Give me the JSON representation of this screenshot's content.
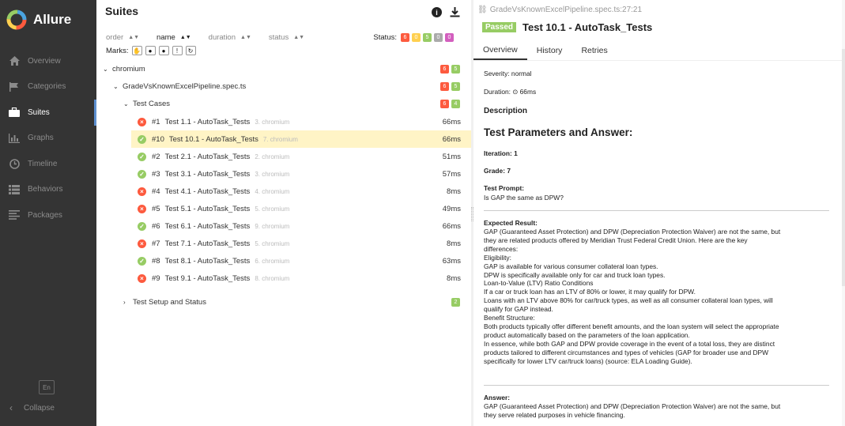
{
  "app": {
    "name": "Allure"
  },
  "sidebar": {
    "items": [
      {
        "label": "Overview",
        "icon": "home-icon"
      },
      {
        "label": "Categories",
        "icon": "flag-icon"
      },
      {
        "label": "Suites",
        "icon": "briefcase-icon",
        "active": true
      },
      {
        "label": "Graphs",
        "icon": "bar-chart-icon"
      },
      {
        "label": "Timeline",
        "icon": "clock-icon"
      },
      {
        "label": "Behaviors",
        "icon": "list-icon"
      },
      {
        "label": "Packages",
        "icon": "align-left-icon"
      }
    ],
    "language": "En",
    "collapse_label": "Collapse"
  },
  "suites": {
    "title": "Suites",
    "sort": {
      "order": "order",
      "name": "name",
      "duration": "duration",
      "status": "status"
    },
    "status_label": "Status:",
    "status_counts": [
      "6",
      "0",
      "5",
      "0",
      "0"
    ],
    "marks_label": "Marks:",
    "tree": {
      "root": {
        "label": "chromium",
        "counts": [
          "6",
          "5"
        ]
      },
      "file": {
        "label": "GradeVsKnownExcelPipeline.spec.ts",
        "counts": [
          "6",
          "5"
        ]
      },
      "group": {
        "label": "Test Cases",
        "counts": [
          "6",
          "4"
        ]
      },
      "tests": [
        {
          "num": "#1",
          "name": "Test 1.1 - AutoTask_Tests",
          "meta": "3. chromium",
          "duration": "66ms",
          "status": "failed"
        },
        {
          "num": "#10",
          "name": "Test 10.1 - AutoTask_Tests",
          "meta": "7. chromium",
          "duration": "66ms",
          "status": "passed",
          "selected": true
        },
        {
          "num": "#2",
          "name": "Test 2.1 - AutoTask_Tests",
          "meta": "2. chromium",
          "duration": "51ms",
          "status": "passed"
        },
        {
          "num": "#3",
          "name": "Test 3.1 - AutoTask_Tests",
          "meta": "3. chromium",
          "duration": "57ms",
          "status": "passed"
        },
        {
          "num": "#4",
          "name": "Test 4.1 - AutoTask_Tests",
          "meta": "4. chromium",
          "duration": "8ms",
          "status": "failed"
        },
        {
          "num": "#5",
          "name": "Test 5.1 - AutoTask_Tests",
          "meta": "5. chromium",
          "duration": "49ms",
          "status": "failed"
        },
        {
          "num": "#6",
          "name": "Test 6.1 - AutoTask_Tests",
          "meta": "9. chromium",
          "duration": "66ms",
          "status": "passed"
        },
        {
          "num": "#7",
          "name": "Test 7.1 - AutoTask_Tests",
          "meta": "5. chromium",
          "duration": "8ms",
          "status": "failed"
        },
        {
          "num": "#8",
          "name": "Test 8.1 - AutoTask_Tests",
          "meta": "6. chromium",
          "duration": "63ms",
          "status": "passed"
        },
        {
          "num": "#9",
          "name": "Test 9.1 - AutoTask_Tests",
          "meta": "8. chromium",
          "duration": "8ms",
          "status": "failed"
        }
      ],
      "setup": {
        "label": "Test Setup and Status",
        "counts": [
          "2"
        ]
      }
    }
  },
  "detail": {
    "path": "GradeVsKnownExcelPipeline.spec.ts:27:21",
    "status_badge": "Passed",
    "title": "Test 10.1 - AutoTask_Tests",
    "tabs": [
      "Overview",
      "History",
      "Retries"
    ],
    "severity": "Severity: normal",
    "duration": "Duration: ⊙ 66ms",
    "description_heading": "Description",
    "params_heading": "Test Parameters and Answer:",
    "iteration": "Iteration: 1",
    "grade": "Grade: 7",
    "prompt_label": "Test Prompt:",
    "prompt_text": "Is GAP the same as DPW?",
    "expected_label": "Expected Result:",
    "expected_text": "GAP (Guaranteed Asset Protection) and DPW (Depreciation Protection Waiver) are not the same, but\nthey are related products offered by Meridian Trust Federal Credit Union. Here are the key\ndifferences:\nEligibility:\nGAP is available for various consumer collateral loan types.\nDPW is specifically available only for car and truck loan types.\nLoan-to-Value (LTV) Ratio Conditions\nIf a car or truck loan has an LTV of 80% or lower, it may qualify for DPW.\nLoans with an LTV above 80% for car/truck types, as well as all consumer collateral loan types, will\nqualify for GAP instead.\nBenefit Structure:\nBoth products typically offer different benefit amounts, and the loan system will select the appropriate\nproduct automatically based on the parameters of the loan application.\nIn essence, while both GAP and DPW provide coverage in the event of a total loss, they are distinct\nproducts tailored to different circumstances and types of vehicles (GAP for broader use and DPW\nspecifically for lower LTV car/truck loans) (source: ELA Loading Guide).",
    "answer_label": "Answer:",
    "answer_text": "GAP (Guaranteed Asset Protection) and DPW (Depreciation Protection Waiver) are not the same, but\nthey serve related purposes in vehicle financing."
  },
  "colors": {
    "sidebar_bg": "#343434",
    "failed": "#fd5a3e",
    "broken": "#ffd050",
    "passed": "#97cc64",
    "skipped": "#aaaaaa",
    "unknown": "#d35ebe",
    "selected_row": "#fff4c6"
  }
}
